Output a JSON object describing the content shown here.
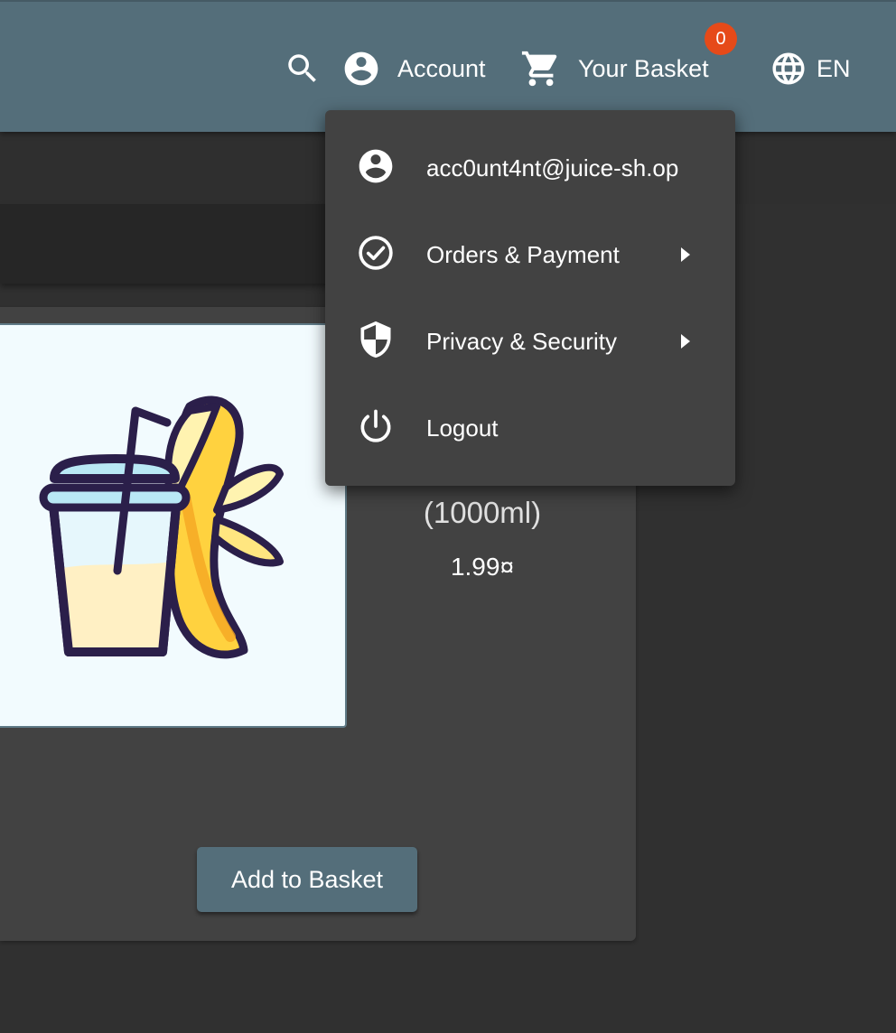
{
  "toolbar": {
    "account_label": "Account",
    "basket_label": "Your Basket",
    "basket_count": "0",
    "language_label": "EN",
    "icons": [
      "search-icon",
      "account-circle-icon",
      "shopping-cart-icon",
      "globe-icon"
    ]
  },
  "account_menu": {
    "items": [
      {
        "label": "acc0unt4nt@juice-sh.op",
        "icon": "account-circle-icon",
        "has_submenu": false
      },
      {
        "label": "Orders & Payment",
        "icon": "check-circle-icon",
        "has_submenu": true
      },
      {
        "label": "Privacy & Security",
        "icon": "shield-icon",
        "has_submenu": true
      },
      {
        "label": "Logout",
        "icon": "power-icon",
        "has_submenu": false
      }
    ]
  },
  "product": {
    "name": "Banana Juice (1000ml)",
    "price": "1.99¤",
    "add_button": "Add to Basket"
  },
  "colors": {
    "toolbar": "#546e7a",
    "background": "#303030",
    "card": "#424242",
    "menu": "#424242",
    "badge": "#e64a19",
    "button": "#546e7a"
  }
}
